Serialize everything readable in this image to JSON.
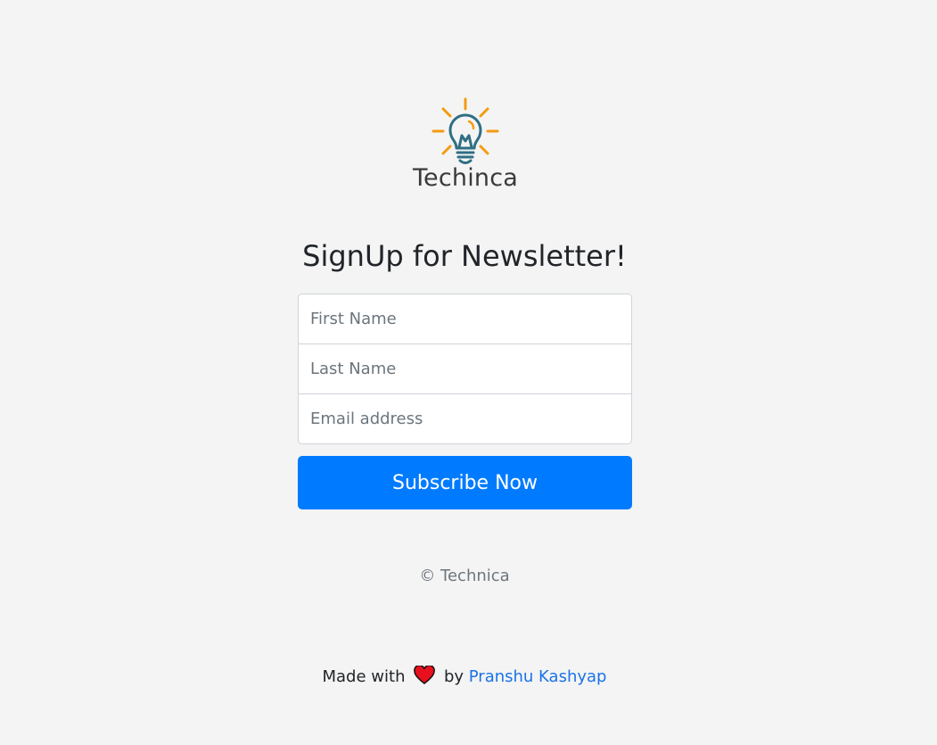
{
  "brand": {
    "logo_text": "Techinca",
    "bulb_color": "#2f6f84",
    "ray_color": "#f39c12"
  },
  "form": {
    "heading": "SignUp for Newsletter!",
    "first_name_placeholder": "First Name",
    "last_name_placeholder": "Last Name",
    "email_placeholder": "Email address",
    "submit_label": "Subscribe Now",
    "submit_color": "#007bff"
  },
  "footer": {
    "copyright": "© Technica",
    "made_with_prefix": "Made with",
    "made_with_by": "by",
    "author_name": "Pranshu Kashyap",
    "heart_icon": "heart-icon"
  }
}
